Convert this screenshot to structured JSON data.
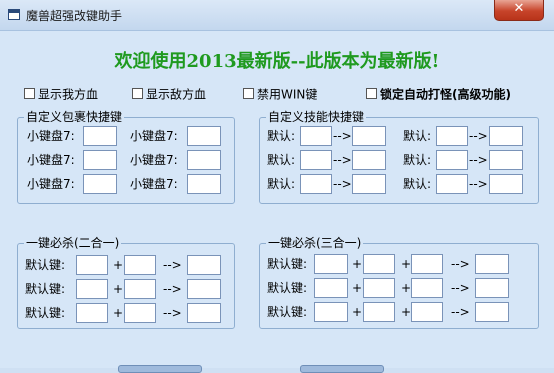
{
  "window": {
    "title": "魔兽超强改键助手",
    "close_label": "✕"
  },
  "banner": "欢迎使用2013最新版--此版本为最新版!",
  "options": [
    {
      "label": "显示我方血",
      "checked": false
    },
    {
      "label": "显示敌方血",
      "checked": false
    },
    {
      "label": "禁用WIN键",
      "checked": false
    },
    {
      "label": "锁定自动打怪(高级功能)",
      "checked": false
    }
  ],
  "groups": {
    "inventory": {
      "title": "自定义包裹快捷键",
      "label": "小键盘7:"
    },
    "skills": {
      "title": "自定义技能快捷键",
      "label": "默认:",
      "arrow": "-->"
    },
    "combo2": {
      "title": "一键必杀(二合一)",
      "label": "默认键:",
      "plus": "+",
      "arrow": "-->"
    },
    "combo3": {
      "title": "一键必杀(三合一)",
      "label": "默认键:",
      "plus": "+",
      "arrow": "-->"
    }
  }
}
